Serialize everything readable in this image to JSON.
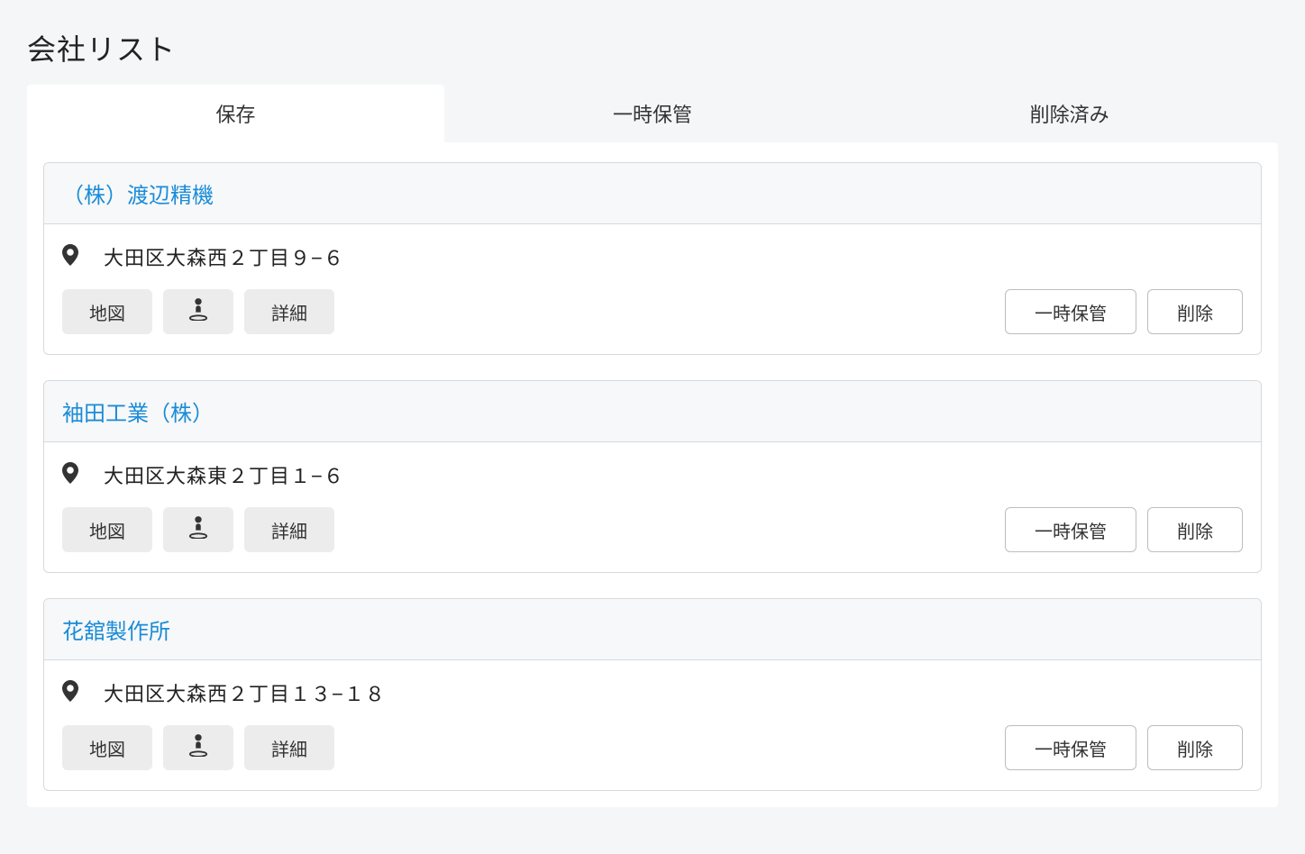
{
  "page_title": "会社リスト",
  "tabs": [
    {
      "label": "保存",
      "active": true
    },
    {
      "label": "一時保管",
      "active": false
    },
    {
      "label": "削除済み",
      "active": false
    }
  ],
  "buttons": {
    "map": "地図",
    "detail": "詳細",
    "archive": "一時保管",
    "delete": "削除"
  },
  "companies": [
    {
      "name": "（株）渡辺精機",
      "address": "大田区大森西２丁目９−６"
    },
    {
      "name": "袖田工業（株）",
      "address": "大田区大森東２丁目１−６"
    },
    {
      "name": "花舘製作所",
      "address": "大田区大森西２丁目１３−１８"
    }
  ]
}
